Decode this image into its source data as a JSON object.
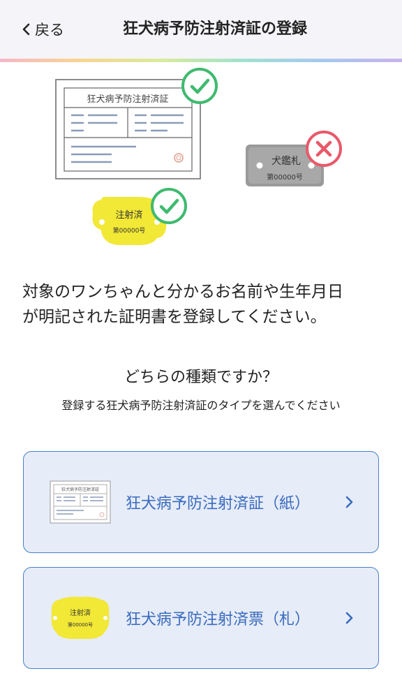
{
  "header": {
    "back_label": "戻る",
    "title": "狂犬病予防注射済証の登録"
  },
  "illustration": {
    "certificate_title": "狂犬病予防注射済証",
    "tag_label": "注射済",
    "tag_number": "第00000号",
    "license_label": "犬鑑札",
    "license_number": "第00000号"
  },
  "main": {
    "description_line1": "対象のワンちゃんと分かるお名前や生年月日",
    "description_line2": "が明記された証明書を登録してください。",
    "question": "どちらの種類ですか？",
    "subtext": "登録する狂犬病予防注射済証のタイプを選んでください"
  },
  "options": [
    {
      "label": "狂犬病予防注射済証（紙）"
    },
    {
      "label": "狂犬病予防注射済票（札）",
      "tag_label": "注射済",
      "tag_number": "第00000号"
    }
  ],
  "colors": {
    "accent": "#3a6bbd",
    "card_bg": "#e6ecf8",
    "check_green": "#3fba6f",
    "cross_red": "#e8596a",
    "tag_yellow": "#f2e836",
    "license_gray": "#9a9a9a"
  }
}
